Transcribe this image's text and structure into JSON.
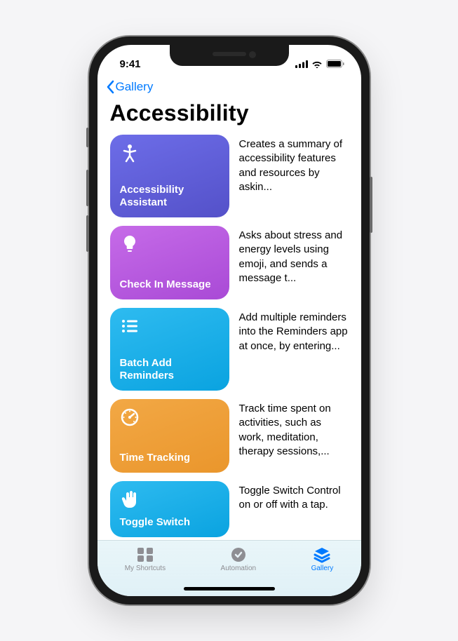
{
  "status": {
    "time": "9:41"
  },
  "nav": {
    "back_label": "Gallery"
  },
  "page": {
    "title": "Accessibility"
  },
  "shortcuts": [
    {
      "title": "Accessibility Assistant",
      "description": "Creates a summary of accessibility features and resources by askin...",
      "icon": "accessibility-icon",
      "color": "purple"
    },
    {
      "title": "Check In Message",
      "description": "Asks about stress and energy levels using emoji, and sends a message t...",
      "icon": "lightbulb-icon",
      "color": "magenta"
    },
    {
      "title": "Batch Add Reminders",
      "description": "Add multiple reminders into the Reminders app at once, by entering...",
      "icon": "list-icon",
      "color": "blue"
    },
    {
      "title": "Time Tracking",
      "description": "Track time spent on activities, such as work, meditation, therapy sessions,...",
      "icon": "gauge-icon",
      "color": "orange"
    },
    {
      "title": "Toggle Switch",
      "description": "Toggle Switch Control on or off with a tap.",
      "icon": "hand-icon",
      "color": "blue"
    }
  ],
  "tabs": {
    "my_shortcuts": "My Shortcuts",
    "automation": "Automation",
    "gallery": "Gallery",
    "active": "gallery"
  }
}
